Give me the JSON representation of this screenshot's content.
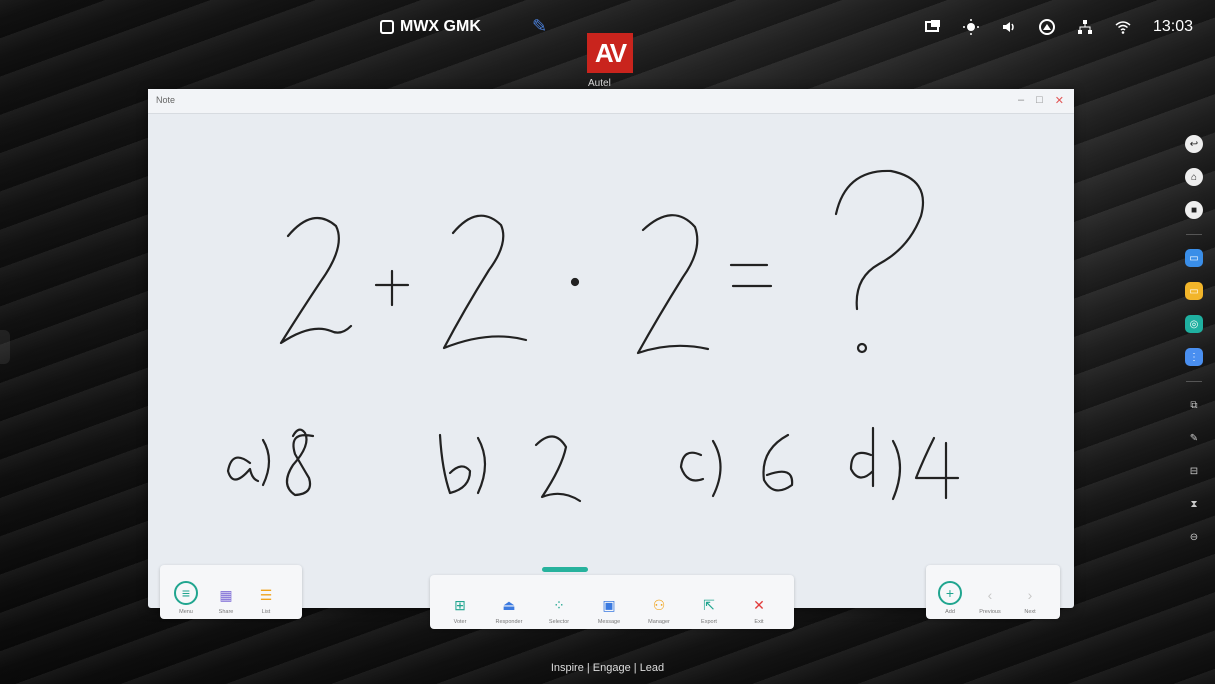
{
  "topbar": {
    "device_name": "MWX GMK",
    "logo_text": "AV",
    "logo_sub": "Autel",
    "status_time": "13:03",
    "icons": [
      "display-icon",
      "brightness-icon",
      "volume-icon",
      "source-icon",
      "network-icon",
      "wifi-icon"
    ]
  },
  "window": {
    "title": "Note",
    "controls": [
      "–",
      "□",
      "✕"
    ]
  },
  "canvas": {
    "line1": "2+2·2=?",
    "answers": [
      "a) 8",
      "b) 2",
      "c) 6",
      "d) 4"
    ]
  },
  "toolbar_left": [
    {
      "icon": "menu-icon",
      "label": "Menu"
    },
    {
      "icon": "share-icon",
      "label": "Share"
    },
    {
      "icon": "list-icon",
      "label": "List"
    }
  ],
  "toolbar_center": [
    {
      "icon": "vote-icon",
      "label": "Voter"
    },
    {
      "icon": "responder-icon",
      "label": "Responder"
    },
    {
      "icon": "selector-icon",
      "label": "Selector"
    },
    {
      "icon": "message-icon",
      "label": "Message"
    },
    {
      "icon": "manager-icon",
      "label": "Manager"
    },
    {
      "icon": "export-icon",
      "label": "Export"
    },
    {
      "icon": "exit-icon",
      "label": "Exit"
    }
  ],
  "toolbar_right": [
    {
      "icon": "add-icon",
      "label": "Add"
    },
    {
      "icon": "previous-icon",
      "label": "Previous"
    },
    {
      "icon": "next-icon",
      "label": "Next"
    }
  ],
  "sidebar": [
    "back",
    "home",
    "recent",
    "chat",
    "files",
    "settings",
    "apps",
    "screen-share",
    "annotate",
    "split",
    "timer",
    "more"
  ],
  "footer": "Inspire  |  Engage  |  Lead",
  "colors": {
    "accent": "#20a58f",
    "logo": "#c9241d",
    "window_bg": "#e8ecf1"
  }
}
